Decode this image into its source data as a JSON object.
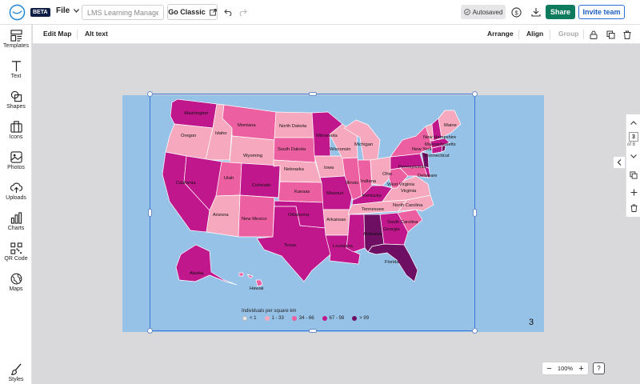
{
  "header": {
    "beta_badge": "BETA",
    "file_menu": "File",
    "title_placeholder": "LMS Learning Managem...",
    "go_classic": "Go Classic",
    "autosaved": "Autosaved",
    "share": "Share",
    "invite_team": "Invite team"
  },
  "sidebar": {
    "items": [
      {
        "label": "Templates",
        "icon": "templates-icon"
      },
      {
        "label": "Text",
        "icon": "text-icon"
      },
      {
        "label": "Shapes",
        "icon": "shapes-icon"
      },
      {
        "label": "Icons",
        "icon": "icons-icon"
      },
      {
        "label": "Photos",
        "icon": "photos-icon"
      },
      {
        "label": "Uploads",
        "icon": "uploads-icon"
      },
      {
        "label": "Charts",
        "icon": "charts-icon"
      },
      {
        "label": "QR Code",
        "icon": "qr-code-icon"
      },
      {
        "label": "Maps",
        "icon": "maps-icon"
      }
    ],
    "styles": "Styles"
  },
  "toolbar": {
    "edit_map": "Edit Map",
    "alt_text": "Alt text",
    "arrange": "Arrange",
    "align": "Align",
    "group": "Group"
  },
  "slide": {
    "number": "3",
    "legend_title": "Individuals per square km",
    "legend": [
      {
        "label": "< 1",
        "color": "#ececec"
      },
      {
        "label": "1 - 33",
        "color": "#f6a9be"
      },
      {
        "label": "34 - 66",
        "color": "#ec5fa0"
      },
      {
        "label": "67 - 98",
        "color": "#c0178c"
      },
      {
        "label": "> 99",
        "color": "#6e0f63"
      }
    ],
    "states": {
      "washington": "Washington",
      "oregon": "Oregon",
      "california": "California",
      "idaho": "Idaho",
      "montana": "Montana",
      "wyoming": "Wyoming",
      "utah": "Utah",
      "arizona": "Arizona",
      "colorado": "Colorado",
      "new_mexico": "New Mexico",
      "north_dakota": "North Dakota",
      "south_dakota": "South Dakota",
      "nebraska": "Nebraska",
      "kansas": "Kansas",
      "oklahoma": "Oklahoma",
      "texas": "Texas",
      "minnesota": "Minnesota",
      "iowa": "Iowa",
      "missouri": "Missouri",
      "arkansas": "Arkansas",
      "louisiana": "Louisiana",
      "wisconsin": "Wisconsin",
      "illinois": "Illinois",
      "michigan": "Michigan",
      "indiana": "Indiana",
      "ohio": "Ohio",
      "kentucky": "Kentucky",
      "tennessee": "Tennessee",
      "mississippi": "Mississippi",
      "alabama": "Alabama",
      "georgia": "Georgia",
      "florida": "Florida",
      "south_carolina": "South Carolina",
      "north_carolina": "North Carolina",
      "virginia": "Virginia",
      "west_virginia": "West Virginia",
      "pennsylvania": "Pennsylvania",
      "new_york": "New York",
      "maine": "Maine",
      "new_hampshire": "New Hampshire",
      "massachusetts": "Massachusetts",
      "connecticut": "Connecticut",
      "delaware": "Delaware",
      "alaska": "Alaska",
      "hawaii": "Hawaii"
    }
  },
  "right_rail": {
    "page_current": "3",
    "page_of": "of 8"
  },
  "zoom": {
    "minus": "−",
    "level": "100%",
    "plus": "+",
    "help": "?"
  },
  "colors": {
    "accent_green": "#0e7a5e",
    "accent_blue": "#1d5fc4",
    "ocean": "#97c2e8"
  }
}
